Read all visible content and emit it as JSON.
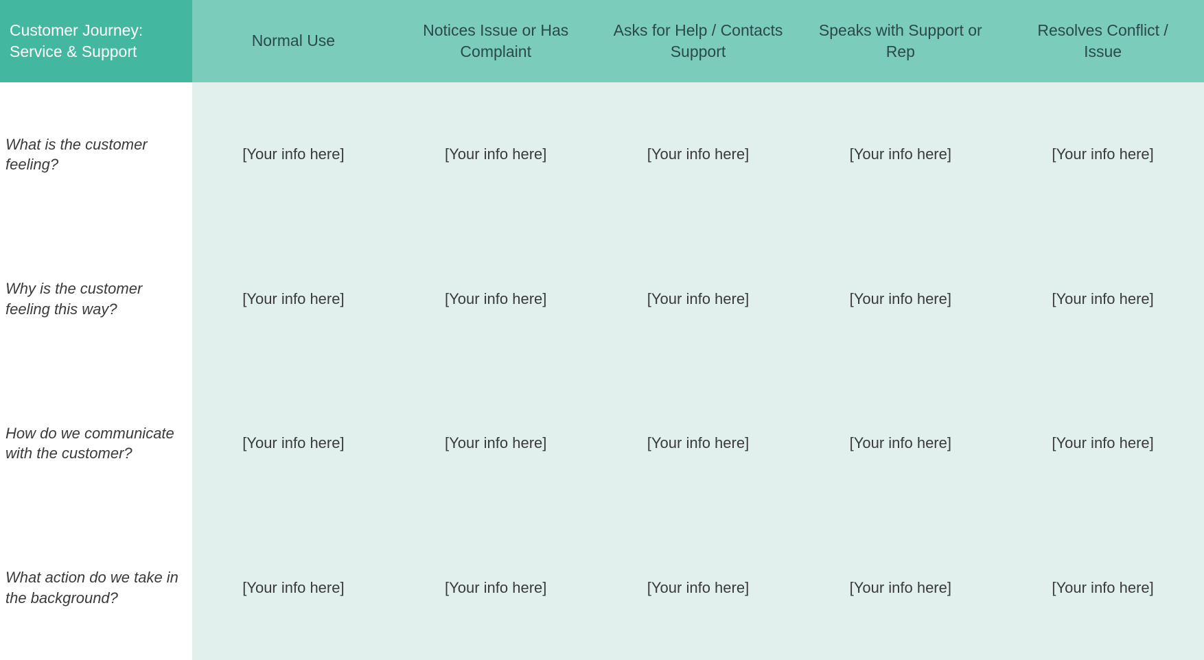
{
  "title": "Customer Journey: Service & Support",
  "columns": [
    "Normal Use",
    "Notices Issue or Has Complaint",
    "Asks for Help / Contacts Support",
    "Speaks with Support or Rep",
    "Resolves Conflict / Issue"
  ],
  "rows": [
    {
      "label": "What is the customer feeling?",
      "cells": [
        "[Your info here]",
        "[Your info here]",
        "[Your info here]",
        "[Your info here]",
        "[Your info here]"
      ]
    },
    {
      "label": "Why is the customer feeling this way?",
      "cells": [
        "[Your info here]",
        "[Your info here]",
        "[Your info here]",
        "[Your info here]",
        "[Your info here]"
      ]
    },
    {
      "label": "How do we communicate with the customer?",
      "cells": [
        "[Your info here]",
        "[Your info here]",
        "[Your info here]",
        "[Your info here]",
        "[Your info here]"
      ]
    },
    {
      "label": "What action do we take in the background?",
      "cells": [
        "[Your info here]",
        "[Your info here]",
        "[Your info here]",
        "[Your info here]",
        "[Your info here]"
      ]
    }
  ]
}
